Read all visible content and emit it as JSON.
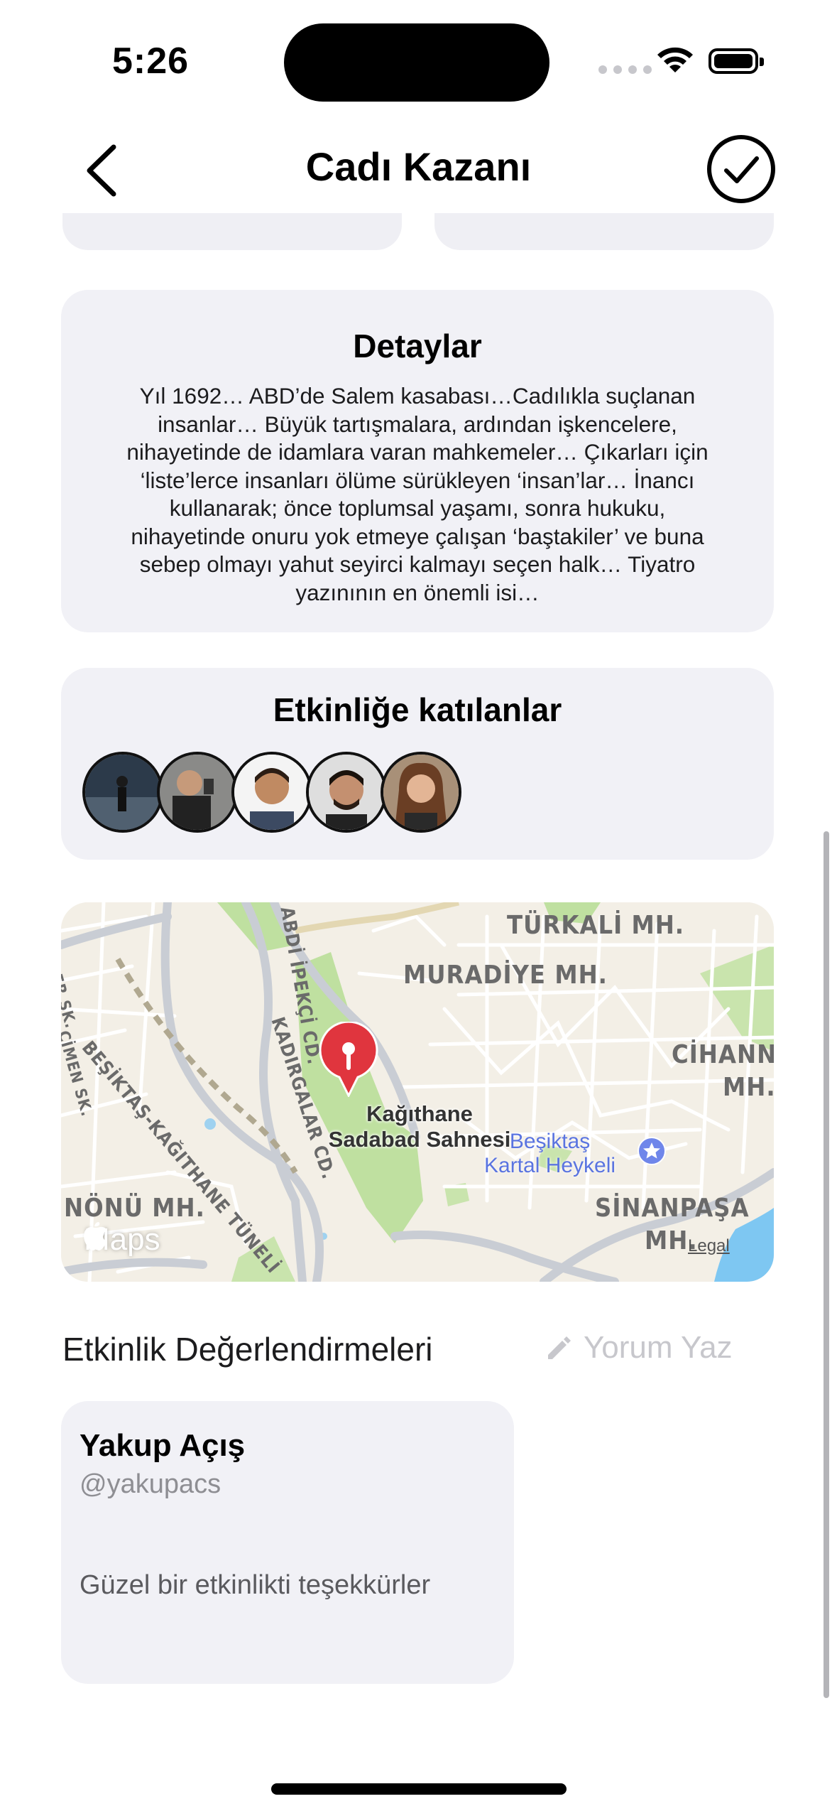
{
  "status_bar": {
    "time": "5:26"
  },
  "nav": {
    "title": "Cadı Kazanı"
  },
  "details": {
    "title": "Detaylar",
    "text": "Yıl 1692… ABD’de Salem kasabası…Cadılıkla suçlanan insanlar… Büyük tartışmalara, ardından işkencelere, nihayetinde de idamlara varan mahkemeler… Çıkarları için ‘liste’lerce insanları ölüme sürükleyen ‘insan’lar… İnancı kullanarak; önce toplumsal yaşamı, sonra hukuku, nihayetinde onuru yok etmeye çalışan ‘baştakiler’ ve buna  sebep olmayı yahut seyirci kalmayı seçen halk… Tiyatro yazınının en önemli isi…"
  },
  "participants": {
    "title": "Etkinliğe katılanlar",
    "count": 5
  },
  "map": {
    "pin_label_line1": "Kağıthane",
    "pin_label_line2": "Sadabad Sahnesi",
    "poi_line1": "Beşiktaş",
    "poi_line2": "Kartal Heykeli",
    "districts": [
      "TÜRKALİ MH.",
      "MURADİYE MH.",
      "CİHANNU",
      "MH.",
      "SİNANPAŞA",
      "MH.",
      "NÖNÜ MH."
    ],
    "streets": [
      "BEŞİKTAŞ-KAĞITHANE TÜNELİ",
      "KADIRGALAR CD.",
      "ABDİ İPEKÇİ CD.",
      "ÇİMEN SK.",
      "ER SK."
    ],
    "brand": "Maps",
    "legal": "Legal",
    "colors": {
      "pin": "#e0353e",
      "poi": "#5a74e0"
    }
  },
  "reviews": {
    "title": "Etkinlik Değerlendirmeleri",
    "write_label": "Yorum Yaz",
    "items": [
      {
        "name": "Yakup Açış",
        "handle": "@yakupacs",
        "text": "Güzel bir etkinlikti teşekkürler"
      }
    ]
  }
}
